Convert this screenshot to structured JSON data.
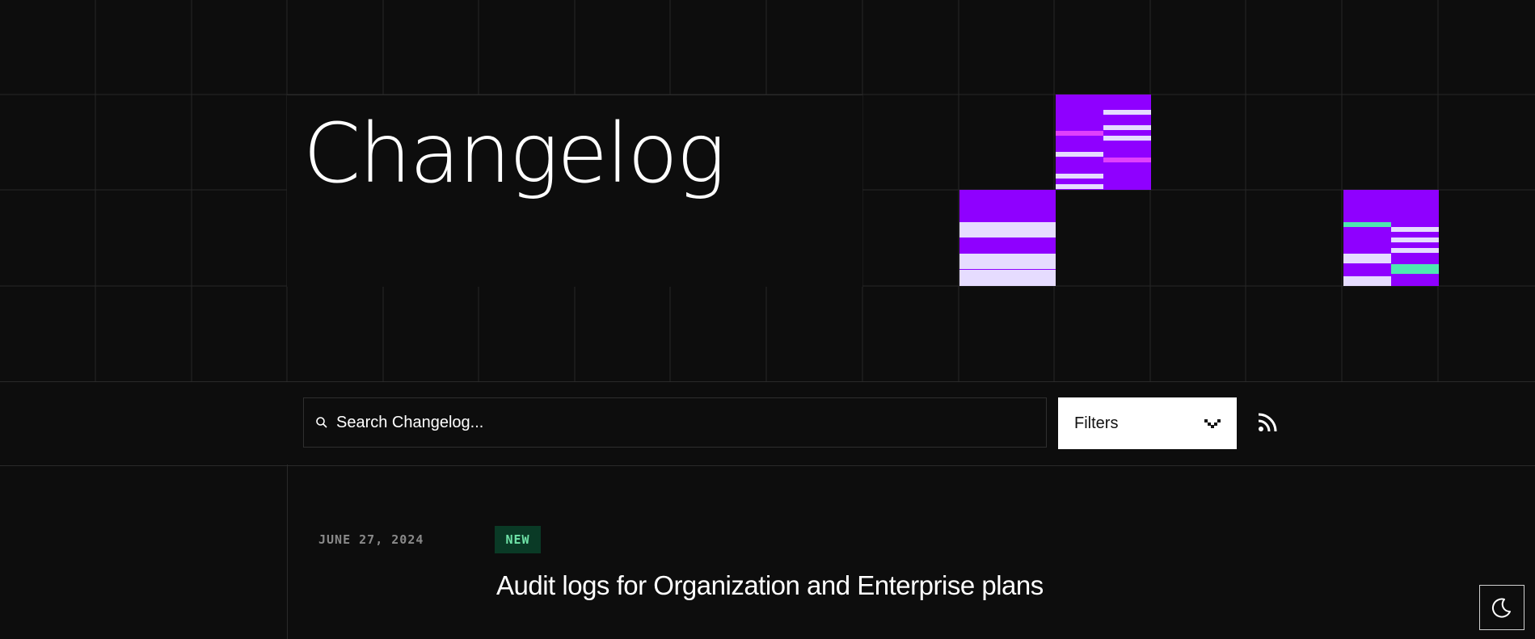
{
  "header": {
    "title": "Changelog"
  },
  "search": {
    "placeholder": "Search Changelog..."
  },
  "filters": {
    "label": "Filters"
  },
  "entries": [
    {
      "date": "JUNE 27, 2024",
      "badge": "NEW",
      "title": "Audit logs for Organization and Enterprise plans"
    }
  ],
  "icons": {
    "search": "search-icon",
    "filters_chevron": "chevron-down-icon",
    "rss": "rss-icon",
    "theme_toggle": "moon-icon"
  },
  "colors": {
    "background": "#0d0d0d",
    "accent_purple": "#8f00ff",
    "accent_magenta": "#e040fb",
    "accent_mint": "#4de8b0",
    "stripe_light": "#e6dcff",
    "badge_bg": "#0a3a26",
    "badge_text": "#6fe3a8"
  }
}
